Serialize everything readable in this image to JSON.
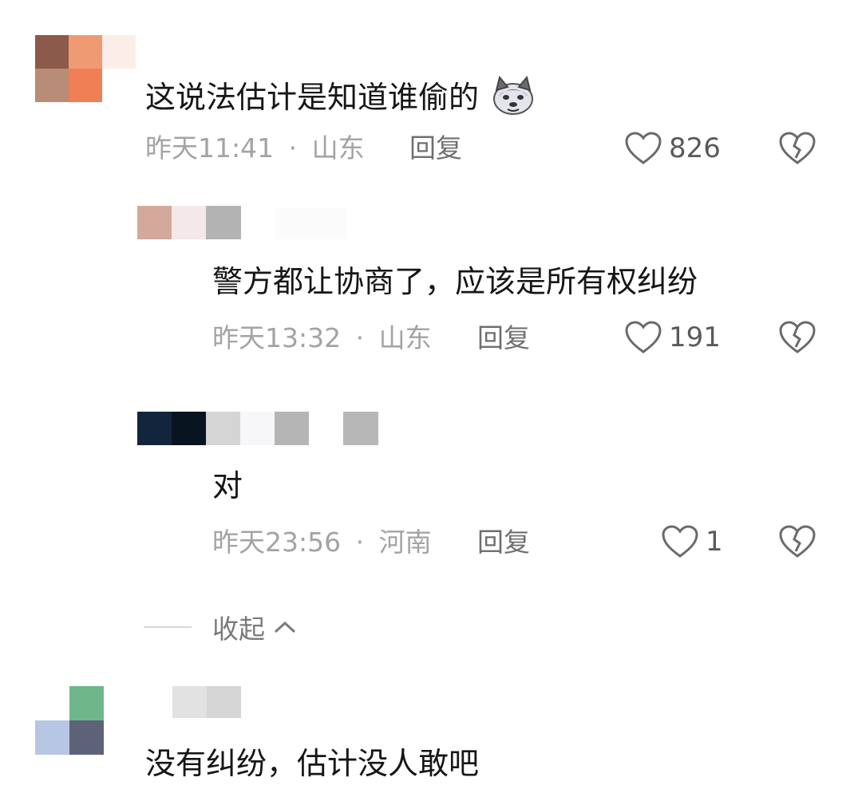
{
  "comments": [
    {
      "text": "这说法估计是知道谁偷的",
      "emoji": "husky-dog-face",
      "time": "昨天11:41",
      "sep": "·",
      "location": "山东",
      "reply_label": "回复",
      "likes": "826"
    }
  ],
  "replies": [
    {
      "text": "警方都让协商了，应该是所有权纠纷",
      "time": "昨天13:32",
      "sep": "·",
      "location": "山东",
      "reply_label": "回复",
      "likes": "191"
    },
    {
      "text": "对",
      "time": "昨天23:56",
      "sep": "·",
      "location": "河南",
      "reply_label": "回复",
      "likes": "1"
    }
  ],
  "collapse": {
    "label": "收起"
  },
  "bottom_comment": {
    "text": "没有纠纷，估计没人敢吧"
  },
  "colors": {
    "meta": "#a3a3a3",
    "text": "#161616"
  }
}
